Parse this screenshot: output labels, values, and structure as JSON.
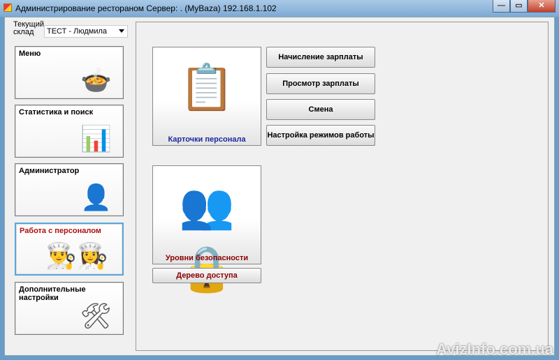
{
  "window": {
    "title": "Администрирование ресторaном  Сервер: . (MyBaza) 192.168.1.102",
    "minimize": "—",
    "maximize": "▭",
    "close": "✕"
  },
  "warehouse": {
    "label": "Текущий склад",
    "value": "ТЕСТ - Людмила"
  },
  "sidebar": {
    "items": [
      {
        "label": "Меню",
        "icon": "pots-icon"
      },
      {
        "label": "Статистика и поиск",
        "icon": "stats-icon"
      },
      {
        "label": "Администратор",
        "icon": "admin-icon"
      },
      {
        "label": "Работа с персоналом",
        "icon": "staff-icon",
        "selected": true
      },
      {
        "label": "Дополнительные настройки",
        "icon": "tools-icon"
      }
    ]
  },
  "main": {
    "cards_label": "Карточки персонала",
    "security_label": "Уровни безопасности",
    "access_tree": "Дерево доступа",
    "buttons": [
      "Начисление зарплаты",
      "Просмотр зарплаты",
      "Смена",
      "Настройка режимов работы"
    ]
  },
  "watermark": "AvizInfo.com.ua",
  "colors": {
    "selected_border": "#5aa7d8",
    "selected_text": "#b01010",
    "cards_text": "#1a2aa0",
    "security_text": "#8b0000"
  }
}
